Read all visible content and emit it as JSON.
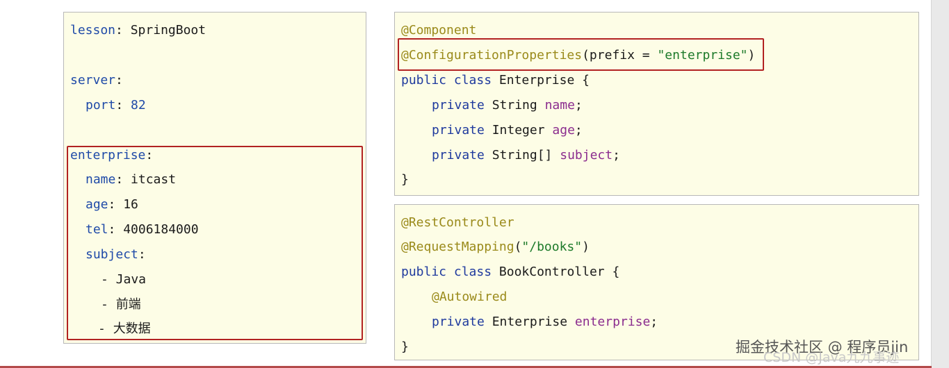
{
  "yaml": {
    "l1_key": "lesson",
    "l1_sep": ": ",
    "l1_val": "SpringBoot",
    "l2_key": "server",
    "l2_sep": ":",
    "l3_key": "port",
    "l3_sep": ": ",
    "l3_val": "82",
    "l4_key": "enterprise",
    "l4_sep": ":",
    "l5_key": "name",
    "l5_sep": ": ",
    "l5_val": "itcast",
    "l6_key": "age",
    "l6_sep": ": ",
    "l6_val": "16",
    "l7_key": "tel",
    "l7_sep": ": ",
    "l7_val": "4006184000",
    "l8_key": "subject",
    "l8_sep": ":",
    "l9": "- Java",
    "l10_dash": "- ",
    "l10_val": "前端",
    "l11_dash": "- ",
    "l11_val": "大数据"
  },
  "entity": {
    "a1": "@Component",
    "a2": "@ConfigurationProperties",
    "a2_open": "(prefix = ",
    "a2_str": "\"enterprise\"",
    "a2_close": ")",
    "c_kw1": "public",
    "c_kw2": "class",
    "c_name": "Enterprise {",
    "f1_kw": "private",
    "f1_type": "String",
    "f1_name": "name",
    "f1_end": ";",
    "f2_kw": "private",
    "f2_type": "Integer",
    "f2_name": "age",
    "f2_end": ";",
    "f3_kw": "private",
    "f3_type": "String[]",
    "f3_name": "subject",
    "f3_end": ";",
    "close": "}"
  },
  "controller": {
    "a1": "@RestController",
    "a2": "@RequestMapping",
    "a2_open": "(",
    "a2_str": "\"/books\"",
    "a2_close": ")",
    "c_kw1": "public",
    "c_kw2": "class",
    "c_name": "BookController {",
    "a3": "@Autowired",
    "f_kw": "private",
    "f_type": "Enterprise",
    "f_name": "enterprise",
    "f_end": ";",
    "close": "}"
  },
  "watermarks": {
    "primary": "掘金技术社区 @ 程序员jin",
    "secondary": "CSDN @Java九九事迹"
  },
  "colors": {
    "panel_bg": "#fdfde6",
    "highlight_border": "#b22222",
    "key": "#1f4aa8",
    "keyword": "#1f3a9e",
    "annotation": "#9a8a1a",
    "string": "#1d7a2a",
    "field": "#8b2c8e"
  }
}
